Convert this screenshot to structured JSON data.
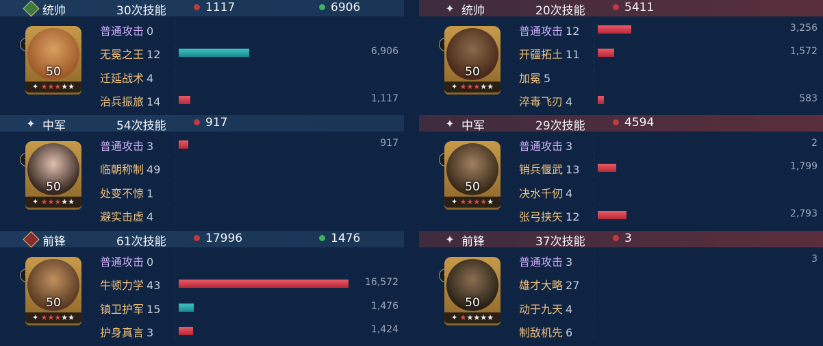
{
  "left_team": {
    "generals": [
      {
        "role": "统帅",
        "role_icon": "heart-shield-icon",
        "skills_count": "30次技能",
        "damage": "1117",
        "heal": "6906",
        "level": "50",
        "red_stars": 3,
        "total_stars": 5,
        "skills": [
          {
            "name": "普通攻击",
            "count": "0",
            "value": "",
            "bar_fraction": 0,
            "bar_color": "red",
            "normal": true
          },
          {
            "name": "无冕之王",
            "count": "12",
            "value": "6,906",
            "bar_fraction": 0.416,
            "bar_color": "teal"
          },
          {
            "name": "迁延战术",
            "count": "4",
            "value": "",
            "bar_fraction": 0,
            "bar_color": "red"
          },
          {
            "name": "治兵振旅",
            "count": "14",
            "value": "1,117",
            "bar_fraction": 0.067,
            "bar_color": "red"
          }
        ]
      },
      {
        "role": "中军",
        "role_icon": "star-icon",
        "skills_count": "54次技能",
        "damage": "917",
        "heal": "",
        "level": "50",
        "red_stars": 3,
        "total_stars": 5,
        "skills": [
          {
            "name": "普通攻击",
            "count": "3",
            "value": "917",
            "bar_fraction": 0.055,
            "bar_color": "red",
            "normal": true
          },
          {
            "name": "临朝称制",
            "count": "49",
            "value": "",
            "bar_fraction": 0,
            "bar_color": "red"
          },
          {
            "name": "处变不惊",
            "count": "1",
            "value": "",
            "bar_fraction": 0,
            "bar_color": "red"
          },
          {
            "name": "避实击虚",
            "count": "4",
            "value": "",
            "bar_fraction": 0,
            "bar_color": "red"
          }
        ]
      },
      {
        "role": "前锋",
        "role_icon": "sword-icon",
        "skills_count": "61次技能",
        "damage": "17996",
        "heal": "1476",
        "level": "50",
        "red_stars": 3,
        "total_stars": 5,
        "skills": [
          {
            "name": "普通攻击",
            "count": "0",
            "value": "",
            "bar_fraction": 0,
            "bar_color": "red",
            "normal": true
          },
          {
            "name": "牛顿力学",
            "count": "43",
            "value": "16,572",
            "bar_fraction": 1.0,
            "bar_color": "red"
          },
          {
            "name": "镇卫护军",
            "count": "15",
            "value": "1,476",
            "bar_fraction": 0.089,
            "bar_color": "teal"
          },
          {
            "name": "护身真言",
            "count": "3",
            "value": "1,424",
            "bar_fraction": 0.086,
            "bar_color": "red"
          }
        ]
      }
    ]
  },
  "right_team": {
    "generals": [
      {
        "role": "统帅",
        "role_icon": "star-icon",
        "skills_count": "20次技能",
        "damage": "5411",
        "heal": "",
        "level": "50",
        "red_stars": 3,
        "total_stars": 5,
        "skills": [
          {
            "name": "普通攻击",
            "count": "12",
            "value": "3,256",
            "bar_fraction": 0.196,
            "bar_color": "red",
            "normal": true
          },
          {
            "name": "开疆拓土",
            "count": "11",
            "value": "1,572",
            "bar_fraction": 0.095,
            "bar_color": "red"
          },
          {
            "name": "加冕",
            "count": "5",
            "value": "",
            "bar_fraction": 0,
            "bar_color": "red"
          },
          {
            "name": "淬毒飞刃",
            "count": "4",
            "value": "583",
            "bar_fraction": 0.035,
            "bar_color": "red"
          }
        ]
      },
      {
        "role": "中军",
        "role_icon": "star-icon",
        "skills_count": "29次技能",
        "damage": "4594",
        "heal": "",
        "level": "50",
        "red_stars": 4,
        "total_stars": 5,
        "skills": [
          {
            "name": "普通攻击",
            "count": "3",
            "value": "2",
            "bar_fraction": 0,
            "bar_color": "red",
            "normal": true
          },
          {
            "name": "销兵偃武",
            "count": "13",
            "value": "1,799",
            "bar_fraction": 0.108,
            "bar_color": "red"
          },
          {
            "name": "决水千仞",
            "count": "4",
            "value": "",
            "bar_fraction": 0,
            "bar_color": "red"
          },
          {
            "name": "张弓挟矢",
            "count": "12",
            "value": "2,793",
            "bar_fraction": 0.168,
            "bar_color": "red"
          }
        ]
      },
      {
        "role": "前锋",
        "role_icon": "star-icon",
        "skills_count": "37次技能",
        "damage": "3",
        "heal": "",
        "level": "50",
        "red_stars": 1,
        "total_stars": 5,
        "skills": [
          {
            "name": "普通攻击",
            "count": "3",
            "value": "3",
            "bar_fraction": 0,
            "bar_color": "red",
            "normal": true
          },
          {
            "name": "雄才大略",
            "count": "27",
            "value": "",
            "bar_fraction": 0,
            "bar_color": "red"
          },
          {
            "name": "动于九天",
            "count": "4",
            "value": "",
            "bar_fraction": 0,
            "bar_color": "red"
          },
          {
            "name": "制敌机先",
            "count": "6",
            "value": "",
            "bar_fraction": 0,
            "bar_color": "red"
          }
        ]
      }
    ]
  },
  "colors": {
    "damage_dot": "#c23840",
    "heal_dot": "#3fb160",
    "normal_attack": "#c7a9f3",
    "skill_name": "#f0c17a"
  }
}
